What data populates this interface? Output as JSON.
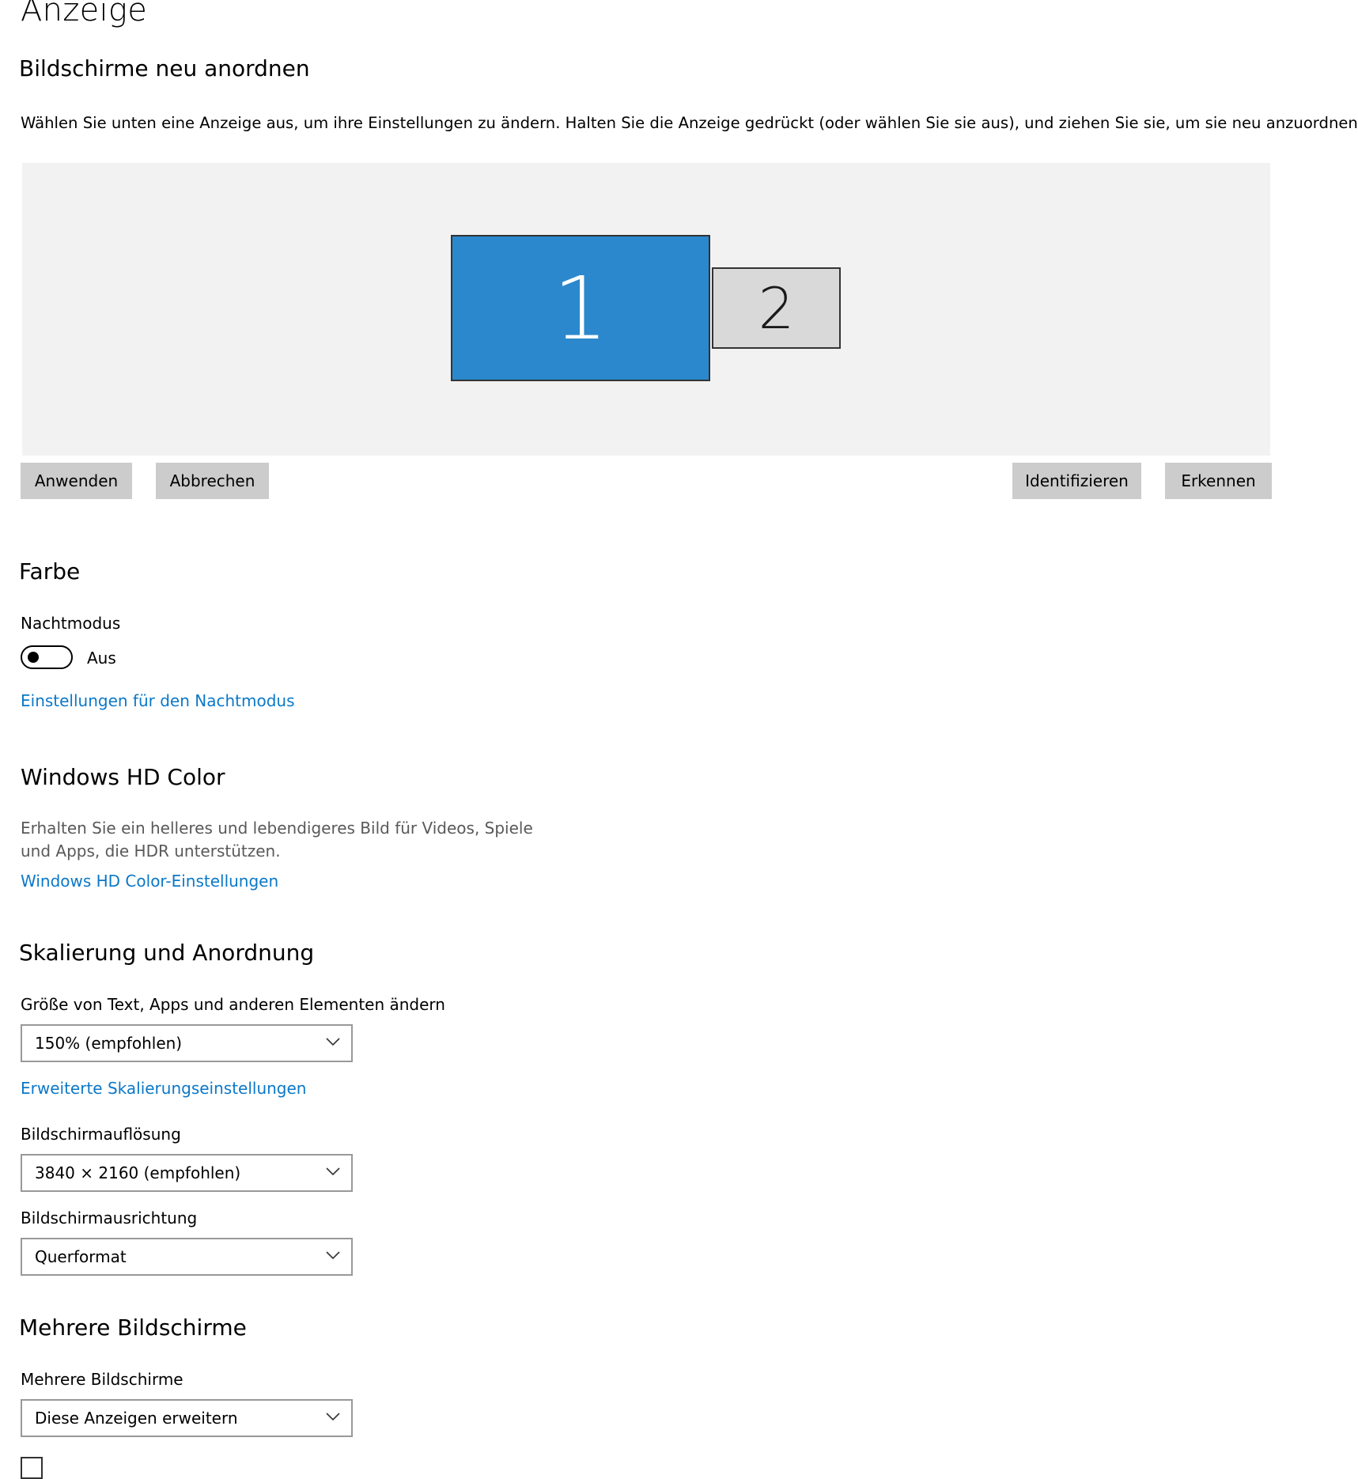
{
  "page": {
    "title": "Anzeige"
  },
  "arrange": {
    "heading": "Bildschirme neu anordnen",
    "description": "Wählen Sie unten eine Anzeige aus, um ihre Einstellungen zu ändern. Halten Sie die Anzeige gedrückt (oder wählen Sie sie aus), und ziehen Sie sie, um sie neu anzuordnen.",
    "monitors": [
      {
        "number": "1",
        "selected": true
      },
      {
        "number": "2",
        "selected": false
      }
    ],
    "buttons": {
      "apply": "Anwenden",
      "cancel": "Abbrechen",
      "identify": "Identifizieren",
      "detect": "Erkennen"
    }
  },
  "color": {
    "heading": "Farbe",
    "night_mode_label": "Nachtmodus",
    "night_mode_state": "Aus",
    "night_mode_on": false,
    "night_mode_link": "Einstellungen für den Nachtmodus"
  },
  "hdr": {
    "heading": "Windows HD Color",
    "description": "Erhalten Sie ein helleres und lebendigeres Bild für Videos, Spiele und Apps, die HDR unterstützen.",
    "link": "Windows HD Color-Einstellungen"
  },
  "scale": {
    "heading": "Skalierung und Anordnung",
    "size_label": "Größe von Text, Apps und anderen Elementen ändern",
    "size_value": "150% (empfohlen)",
    "advanced_link": "Erweiterte Skalierungseinstellungen",
    "resolution_label": "Bildschirmauflösung",
    "resolution_value": "3840 × 2160 (empfohlen)",
    "orientation_label": "Bildschirmausrichtung",
    "orientation_value": "Querformat"
  },
  "multi": {
    "heading": "Mehrere Bildschirme",
    "label": "Mehrere Bildschirme",
    "value": "Diese Anzeigen erweitern"
  },
  "colors": {
    "accent": "#2b88cd",
    "link": "#0b78c8",
    "button_bg": "#cccccc",
    "area_bg": "#f2f2f2"
  },
  "icons": {
    "dropdown": "chevron-down-icon",
    "toggle": "toggle-switch"
  }
}
